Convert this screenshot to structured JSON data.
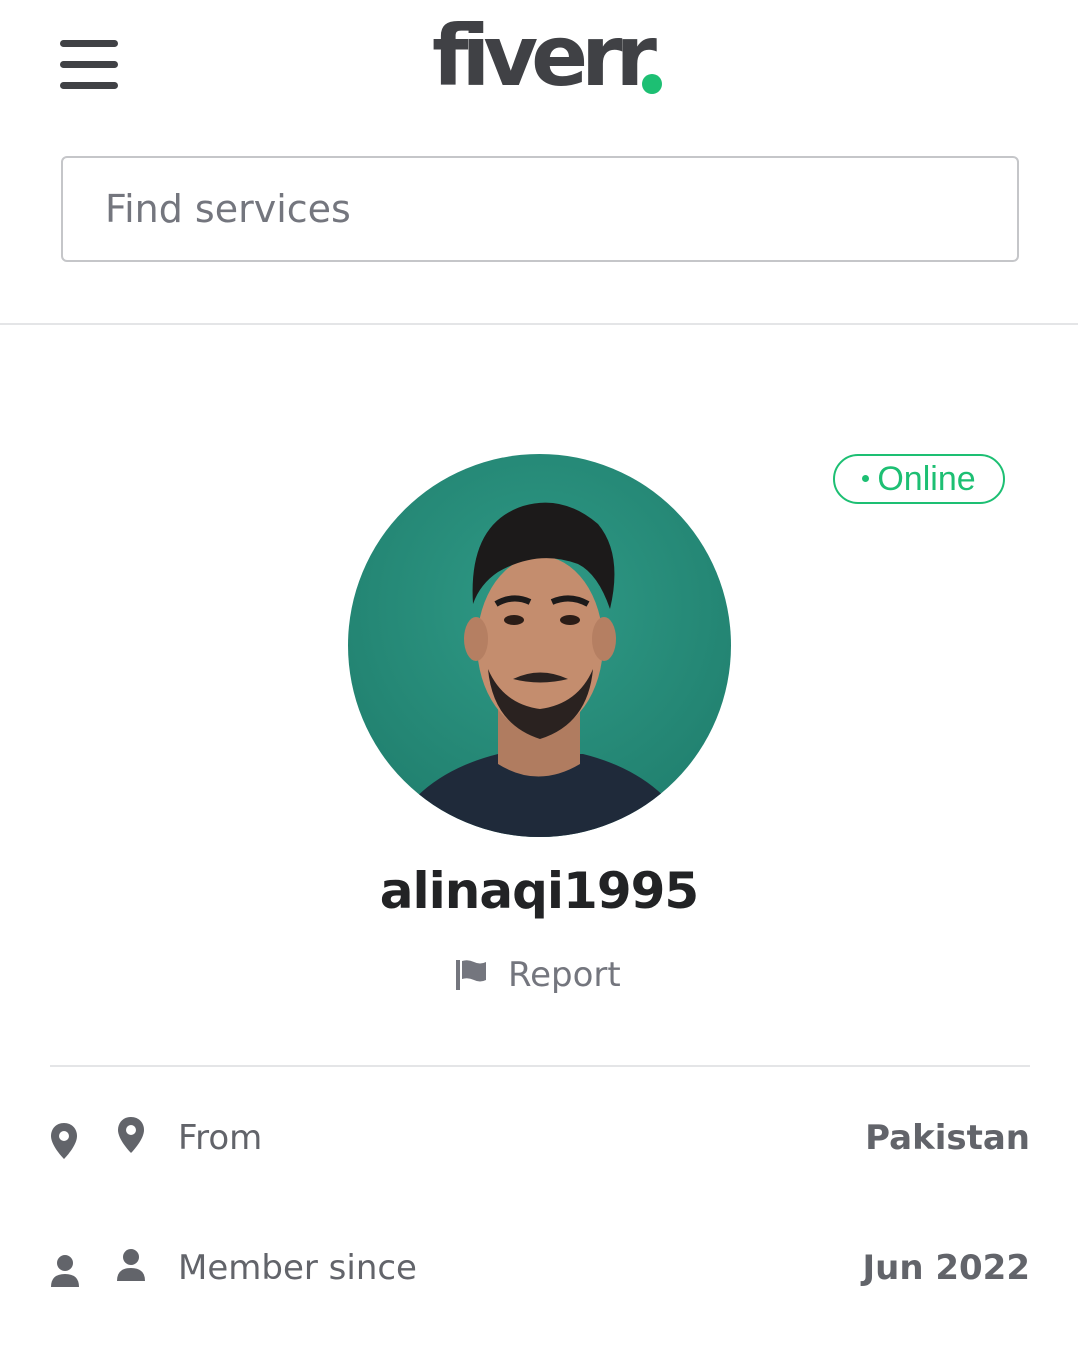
{
  "header": {
    "logo_text": "fiverr",
    "logo_dot_color": "#1dbf73",
    "menu_icon": "hamburger-menu-icon"
  },
  "search": {
    "placeholder": "Find services",
    "value": ""
  },
  "profile": {
    "status": "Online",
    "status_color": "#1dbf73",
    "username": "alinaqi1995",
    "report_label": "Report",
    "report_icon": "flag-icon"
  },
  "stats": [
    {
      "icon": "location-pin-icon",
      "label": "From",
      "value": "Pakistan"
    },
    {
      "icon": "user-icon",
      "label": "Member since",
      "value": "Jun 2022"
    }
  ]
}
